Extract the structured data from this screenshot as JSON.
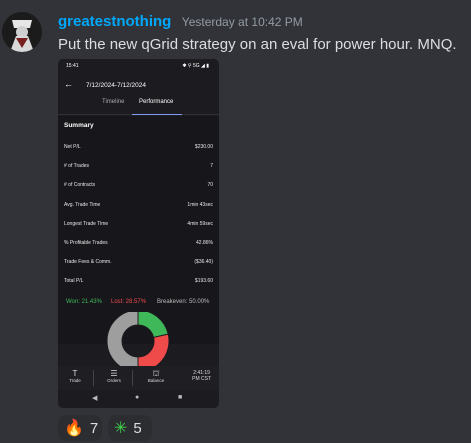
{
  "message": {
    "username": "greatestnothing",
    "timestamp": "Yesterday at 10:42 PM",
    "text": "Put the new qGrid strategy on an eval for power hour. MNQ."
  },
  "phone": {
    "status_time": "15:41",
    "status_right": "✱ ⚲ 5G ◢ ▮",
    "date_range": "7/12/2024-7/12/2024",
    "tabs": [
      "Timeline",
      "Performance"
    ],
    "active_tab": "Performance",
    "summary_title": "Summary",
    "summary_rows": [
      {
        "label": "Net P/L",
        "value": "$230.00"
      },
      {
        "label": "# of Trades",
        "value": "7"
      },
      {
        "label": "# of Contracts",
        "value": "70"
      },
      {
        "label": "Avg. Trade Time",
        "value": "1min 43sec"
      },
      {
        "label": "Longest Trade Time",
        "value": "4min 59sec"
      },
      {
        "label": "% Profitable Trades",
        "value": "42.86%"
      },
      {
        "label": "Trade Fees & Comm.",
        "value": "($36.40)"
      },
      {
        "label": "Total P/L",
        "value": "$193.60"
      }
    ],
    "stats": {
      "won": "Won: 21.43%",
      "lost": "Lost: 28.57%",
      "breakeven": "Breakeven: 50.00%"
    },
    "donut": {
      "won_pct": 21.43,
      "lost_pct": 28.57,
      "breakeven_pct": 50.0,
      "colors": {
        "won": "#3fb85a",
        "lost": "#ef4b4b",
        "breakeven": "#9e9e9e"
      }
    },
    "nav": [
      {
        "label": "Trade",
        "icon": "T"
      },
      {
        "label": "Orders",
        "icon": "☰"
      },
      {
        "label": "Balance",
        "icon": "⛫"
      }
    ],
    "clock": {
      "time": "2:41:19",
      "zone": "PM CST"
    }
  },
  "reactions": [
    {
      "emoji": "🔥",
      "count": "7",
      "icon": "fire-icon"
    },
    {
      "emoji": "✳",
      "count": "5",
      "icon": "green-sparkle-icon"
    }
  ]
}
